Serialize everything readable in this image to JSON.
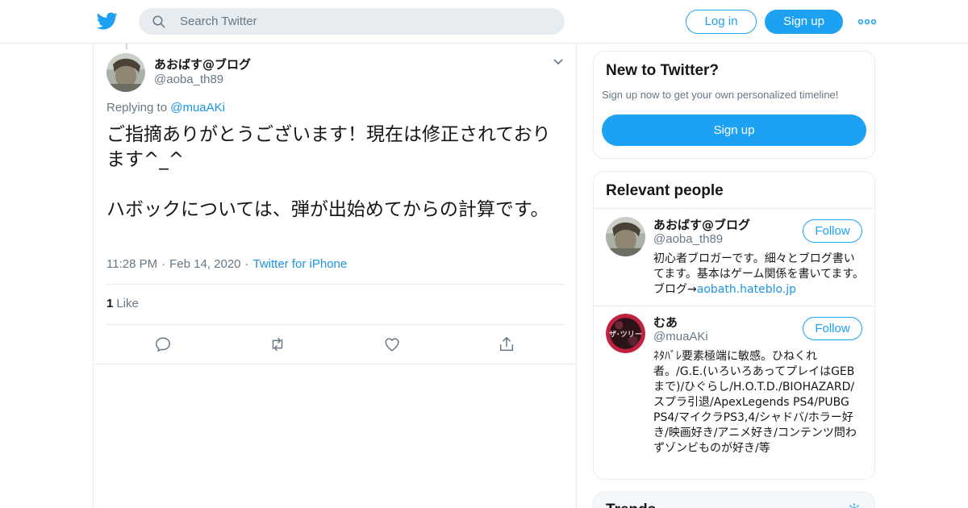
{
  "header": {
    "search_placeholder": "Search Twitter",
    "login_label": "Log in",
    "signup_label": "Sign up",
    "brand_color": "#1da1f2"
  },
  "tweet": {
    "author_name": "あおばす@ブログ",
    "author_handle": "@aoba_th89",
    "replying_prefix": "Replying to",
    "replying_to": "@muaAKi",
    "text": "ご指摘ありがとうございます！現在は修正されております^_^\n\nハボックについては、弾が出始めてからの計算です。",
    "time": "11:28 PM",
    "date": "Feb 14, 2020",
    "source": "Twitter for iPhone",
    "like_count": "1",
    "like_label": "Like"
  },
  "sidebar": {
    "new_title": "New to Twitter?",
    "new_subtitle": "Sign up now to get your own personalized timeline!",
    "new_signup_label": "Sign up",
    "relevant_title": "Relevant people",
    "people": [
      {
        "name": "あおばす@ブログ",
        "handle": "@aoba_th89",
        "follow_label": "Follow",
        "bio": "初心者ブロガーです。細々とブログ書いてます。基本はゲーム関係を書いてます。ブログ→",
        "bio_link": "aobath.hateblo.jp"
      },
      {
        "name": "むあ",
        "handle": "@muaAKi",
        "follow_label": "Follow",
        "bio": "ﾈﾀﾊﾞﾚ要素極端に敏感。ひねくれ者。/G.E.(いろいろあってプレイはGEBまで)/ひぐらし/H.O.T.D./BIOHAZARD/スプラ引退/ApexLegends PS4/PUBG PS4/マイクラPS3,4/シャドバ/ホラー好き/映画好き/アニメ好き/コンテンツ問わずゾンビものが好き/等",
        "avatar_text": "ザ･ツリー"
      }
    ],
    "trends_title": "Trends"
  }
}
